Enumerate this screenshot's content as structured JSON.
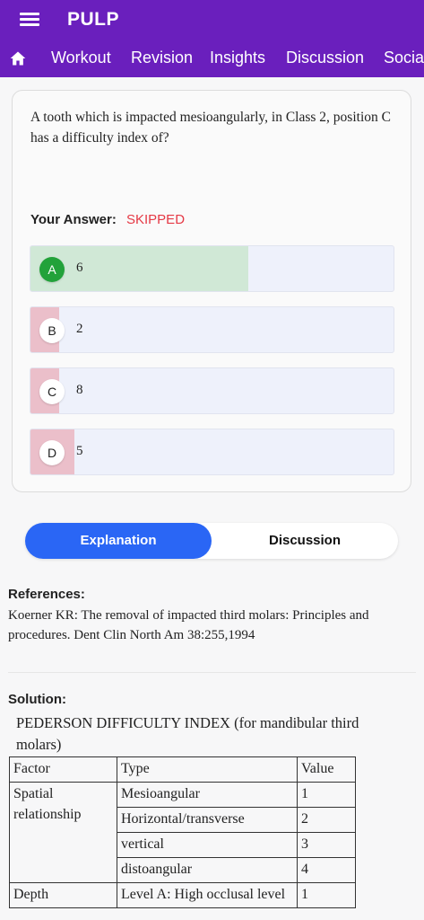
{
  "app": {
    "title": "PULP"
  },
  "nav": {
    "tabs": [
      "Workout",
      "Revision",
      "Insights",
      "Discussion",
      "Social"
    ]
  },
  "question": {
    "text": "A tooth which is impacted mesioangularly, in Class 2, position C has a difficulty index of?",
    "answer_label": "Your Answer:",
    "answer_value": "SKIPPED",
    "options": [
      {
        "letter": "A",
        "text": "6",
        "percent": 60,
        "correct": true
      },
      {
        "letter": "B",
        "text": "2",
        "percent": 8,
        "correct": false
      },
      {
        "letter": "C",
        "text": "8",
        "percent": 8,
        "correct": false
      },
      {
        "letter": "D",
        "text": "5",
        "percent": 12,
        "correct": false
      }
    ]
  },
  "toggle": {
    "explanation": "Explanation",
    "discussion": "Discussion"
  },
  "references": {
    "heading": "References:",
    "text": "Koerner KR: The removal of impacted third molars: Principles and procedures. Dent Clin North Am 38:255,1994"
  },
  "solution": {
    "heading": "Solution:",
    "intro": "PEDERSON DIFFICULTY INDEX (for mandibular third molars)",
    "table": {
      "headers": [
        "Factor",
        "Type",
        "Value"
      ],
      "groups": [
        {
          "factor": "Spatial relationship",
          "rows": [
            {
              "type": "Mesioangular",
              "value": "1"
            },
            {
              "type": "Horizontal/transverse",
              "value": "2"
            },
            {
              "type": "vertical",
              "value": "3"
            },
            {
              "type": "distoangular",
              "value": "4"
            }
          ]
        },
        {
          "factor": "Depth",
          "rows": [
            {
              "type": "Level A: High occlusal level",
              "value": "1"
            }
          ]
        }
      ]
    }
  },
  "colors": {
    "primary": "#6a1fbd",
    "accent": "#2a66f5",
    "correct_fill": "#d0e8d6",
    "correct_badge": "#22a23a",
    "wrong_fill": "#ebbfca",
    "skipped": "#e53945"
  }
}
